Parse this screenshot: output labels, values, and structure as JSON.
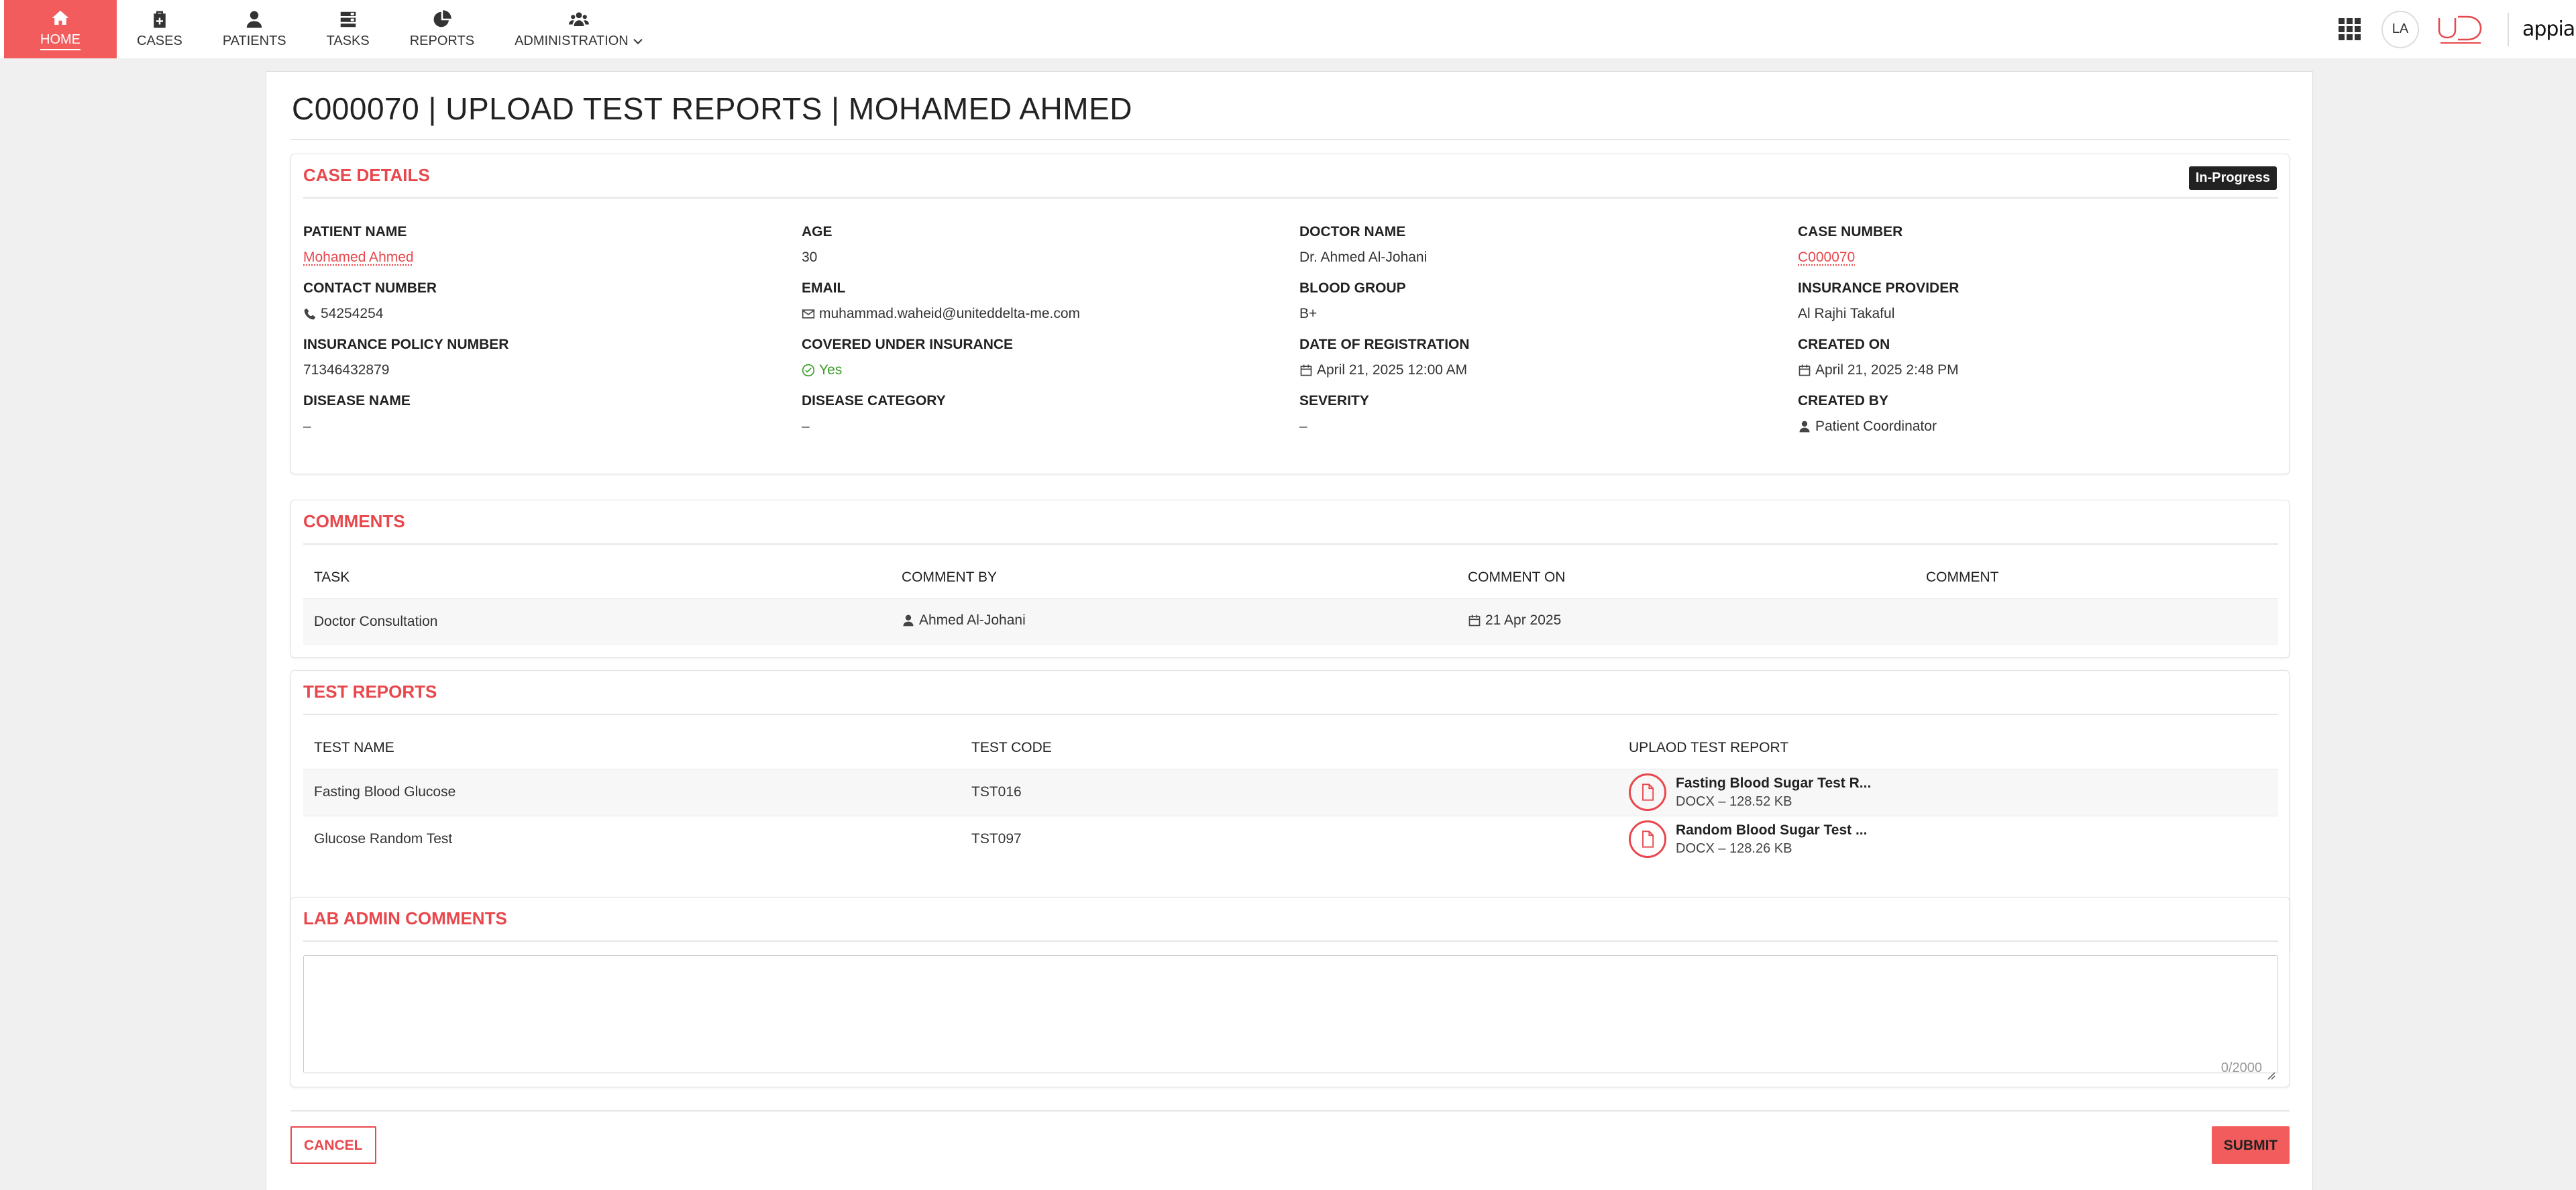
{
  "nav": {
    "items": [
      {
        "label": "HOME",
        "icon": "home-icon"
      },
      {
        "label": "CASES",
        "icon": "medical-case-icon"
      },
      {
        "label": "PATIENTS",
        "icon": "person-icon"
      },
      {
        "label": "TASKS",
        "icon": "tasks-icon"
      },
      {
        "label": "REPORTS",
        "icon": "pie-chart-icon"
      },
      {
        "label": "ADMINISTRATION",
        "icon": "users-cog-icon"
      }
    ],
    "avatar": "LA",
    "brand": "appian",
    "accent": "#f25c5c"
  },
  "page": {
    "title": "C000070 | UPLOAD TEST REPORTS | MOHAMED AHMED"
  },
  "case_details": {
    "title": "CASE DETAILS",
    "status": "In-Progress",
    "fields": {
      "patient_name": {
        "label": "PATIENT NAME",
        "value": "Mohamed Ahmed"
      },
      "age": {
        "label": "AGE",
        "value": "30"
      },
      "doctor_name": {
        "label": "DOCTOR NAME",
        "value": "Dr. Ahmed Al-Johani"
      },
      "case_number": {
        "label": "CASE NUMBER",
        "value": "C000070"
      },
      "contact_number": {
        "label": "CONTACT NUMBER",
        "value": "54254254"
      },
      "email": {
        "label": "EMAIL",
        "value": "muhammad.waheid@uniteddelta-me.com"
      },
      "blood_group": {
        "label": "BLOOD GROUP",
        "value": "B+"
      },
      "insurance_provider": {
        "label": "INSURANCE PROVIDER",
        "value": "Al Rajhi Takaful"
      },
      "policy_number": {
        "label": "INSURANCE POLICY NUMBER",
        "value": "71346432879"
      },
      "covered": {
        "label": "COVERED UNDER INSURANCE",
        "value": "Yes"
      },
      "registration_date": {
        "label": "DATE OF REGISTRATION",
        "value": "April 21, 2025 12:00 AM"
      },
      "created_on": {
        "label": "CREATED ON",
        "value": "April 21, 2025 2:48 PM"
      },
      "disease_name": {
        "label": "DISEASE NAME",
        "value": "–"
      },
      "disease_category": {
        "label": "DISEASE CATEGORY",
        "value": "–"
      },
      "severity": {
        "label": "SEVERITY",
        "value": "–"
      },
      "created_by": {
        "label": "CREATED BY",
        "value": "Patient Coordinator"
      }
    }
  },
  "comments": {
    "title": "COMMENTS",
    "columns": [
      "TASK",
      "COMMENT BY",
      "COMMENT ON",
      "COMMENT"
    ],
    "rows": [
      {
        "task": "Doctor Consultation",
        "by": "Ahmed Al-Johani",
        "on": "21 Apr 2025",
        "comment": ""
      }
    ]
  },
  "test_reports": {
    "title": "TEST REPORTS",
    "columns": [
      "TEST NAME",
      "TEST CODE",
      "UPLAOD TEST REPORT"
    ],
    "rows": [
      {
        "name": "Fasting Blood Glucose",
        "code": "TST016",
        "file": "Fasting Blood Sugar Test R...",
        "meta": "DOCX – 128.52 KB"
      },
      {
        "name": "Glucose Random Test",
        "code": "TST097",
        "file": "Random Blood Sugar Test ...",
        "meta": "DOCX – 128.26 KB"
      }
    ]
  },
  "lab_admin": {
    "title": "LAB ADMIN COMMENTS",
    "value": "",
    "counter": "0/2000"
  },
  "actions": {
    "cancel": "CANCEL",
    "submit": "SUBMIT"
  }
}
